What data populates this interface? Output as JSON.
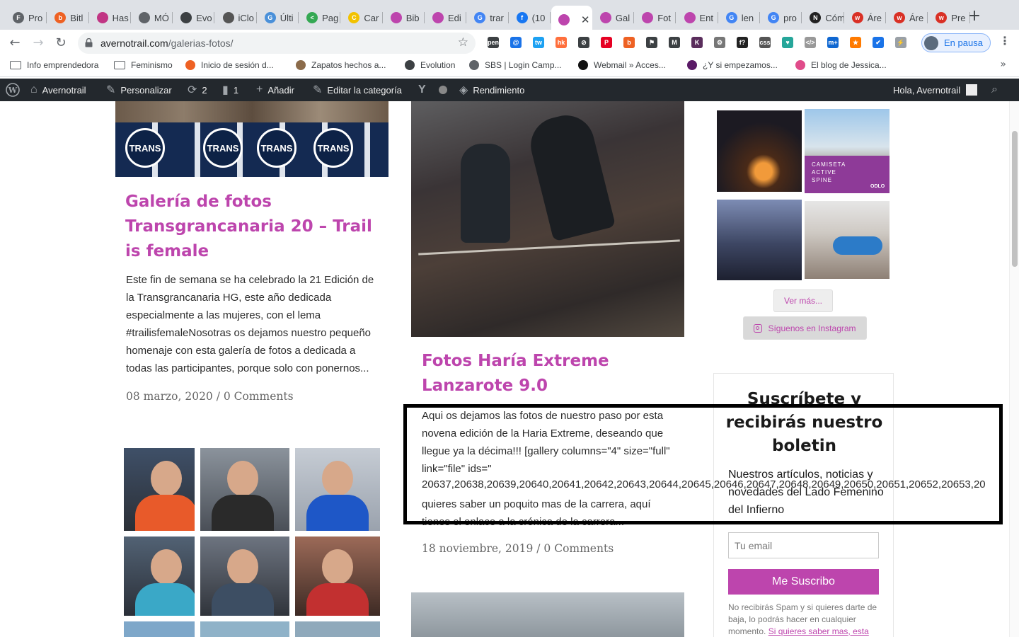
{
  "browser": {
    "tabs": [
      {
        "label": "Pro",
        "icon": "FB",
        "color": "#5f6368"
      },
      {
        "label": "Bitl",
        "icon": "b",
        "color": "#ee6123"
      },
      {
        "label": "Has",
        "icon": "ig",
        "color": "#c13584"
      },
      {
        "label": "MÓ",
        "icon": "globe",
        "color": "#5f6368"
      },
      {
        "label": "Evo",
        "icon": "oo",
        "color": "#3c4043"
      },
      {
        "label": "iClo",
        "icon": "apple",
        "color": "#555555"
      },
      {
        "label": "Últi",
        "icon": "GT",
        "color": "#4a90d9"
      },
      {
        "label": "Pag",
        "icon": "<>",
        "color": "#34a853"
      },
      {
        "label": "Car",
        "icon": "C",
        "color": "#f2c200"
      },
      {
        "label": "Bib",
        "icon": "crown",
        "color": "#bd45ad"
      },
      {
        "label": "Edi",
        "icon": "crown",
        "color": "#bd45ad"
      },
      {
        "label": "trar",
        "icon": "G",
        "color": "#4285f4"
      },
      {
        "label": "(10",
        "icon": "f",
        "color": "#1877f2"
      },
      {
        "label": "",
        "icon": "crown",
        "color": "#bd45ad"
      },
      {
        "label": "Gal",
        "icon": "crown",
        "color": "#bd45ad"
      },
      {
        "label": "Fot",
        "icon": "crown",
        "color": "#bd45ad"
      },
      {
        "label": "Ent",
        "icon": "crown",
        "color": "#bd45ad"
      },
      {
        "label": "len",
        "icon": "G",
        "color": "#4285f4"
      },
      {
        "label": "pro",
        "icon": "G",
        "color": "#4285f4"
      },
      {
        "label": "Cóm",
        "icon": "NB",
        "color": "#222222"
      },
      {
        "label": "Áre",
        "icon": "w",
        "color": "#d93025"
      },
      {
        "label": "Áre",
        "icon": "w",
        "color": "#d93025"
      },
      {
        "label": "Pre",
        "icon": "w",
        "color": "#d93025"
      }
    ],
    "active_close": "✕",
    "new_tab": "+",
    "url_host": "avernotrail.com",
    "url_path": "/galerias-fotos/",
    "profile_label": "En pausa",
    "extensions": [
      {
        "icon": "pen",
        "color": "#3c4043"
      },
      {
        "icon": "@",
        "color": "#1a73e8"
      },
      {
        "icon": "tw",
        "color": "#1da1f2"
      },
      {
        "icon": "hk",
        "color": "#ff6f3c"
      },
      {
        "icon": "⊘",
        "color": "#3c4043"
      },
      {
        "icon": "P",
        "color": "#e60023"
      },
      {
        "icon": "b",
        "color": "#ee6123"
      },
      {
        "icon": "⚑",
        "color": "#3c4043"
      },
      {
        "icon": "M",
        "color": "#3c4043"
      },
      {
        "icon": "K",
        "color": "#5a2d5c"
      },
      {
        "icon": "⚙",
        "color": "#777777"
      },
      {
        "icon": "f?",
        "color": "#222222"
      },
      {
        "icon": "css",
        "color": "#555555"
      },
      {
        "icon": "♥",
        "color": "#26a69a"
      },
      {
        "icon": "</>",
        "color": "#999999"
      },
      {
        "icon": "m+",
        "color": "#0f67d1"
      },
      {
        "icon": "★",
        "color": "#ff7a00"
      },
      {
        "icon": "✔",
        "color": "#1a73e8"
      },
      {
        "icon": "⚡",
        "color": "#9aa0a6"
      }
    ],
    "bookmarks": [
      {
        "label": "Info emprendedora",
        "icon": "folder"
      },
      {
        "label": "Feminismo",
        "icon": "folder"
      },
      {
        "label": "Inicio de sesión d...",
        "icon": "link"
      },
      {
        "label": "Zapatos hechos a...",
        "icon": "shoe"
      },
      {
        "label": "Evolution",
        "icon": "oo"
      },
      {
        "label": "SBS | Login Camp...",
        "icon": "globe"
      },
      {
        "label": "Webmail » Acces...",
        "icon": "I"
      },
      {
        "label": "¿Y si empezamos...",
        "icon": "bb"
      },
      {
        "label": "El blog de Jessica...",
        "icon": "pink"
      }
    ],
    "bookmarks_more": "»"
  },
  "adminbar": {
    "site": "Avernotrail",
    "customize": "Personalizar",
    "updates": "2",
    "comments": "1",
    "add": "Añadir",
    "edit_category": "Editar la categoría",
    "performance": "Rendimiento",
    "greeting": "Hola, Avernotrail"
  },
  "posts": [
    {
      "title": "Galería de fotos Transgrancanaria 20 – Trail is female",
      "excerpt": "Este fin de semana se ha celebrado la 21 Edición de la Transgrancanaria HG, este año dedicada especialmente a las mujeres, con el lema #trailisfemaleNosotras os dejamos nuestro pequeño homenaje con esta galería de fotos a dedicada a todas las participantes, porque solo con ponernos...",
      "meta": "08 marzo, 2020 / 0 Comments",
      "image_text": "TRANS"
    },
    {
      "title": "Fotos Haría Extreme Lanzarote 9.0",
      "excerpt": "Aqui os dejamos las fotos de nuestro paso por esta novena edición de la Haria Extreme, deseando que llegue ya la décima!!! [gallery columns=\"4\" size=\"full\" link=\"file\" ids=\"",
      "excerpt_tail": "quieres saber un poquito mas de la carrera, aquí tienes el enlace a la crónica de la carrera...",
      "ids_overflow": "20637,20638,20639,20640,20641,20642,20643,20644,20645,20646,20647,20648,20649,20650,20651,20652,20653,20",
      "meta": "18 noviembre, 2019 / 0 Comments"
    }
  ],
  "sidebar": {
    "instagram_tile_text": [
      "CAMISETA",
      "ACTIVE",
      "SPINE"
    ],
    "instagram_tile_brand": "ODLO",
    "see_more": "Ver más...",
    "follow_instagram": "Síguenos en Instagram",
    "newsletter": {
      "title": "Suscríbete y recibirás nuestro boletin",
      "subtitle": "Nuestros artículos, noticias y novedades del Lado Femenino del Infierno",
      "email_placeholder": "Tu email",
      "submit": "Me Suscribo",
      "note": "No recibirás Spam y si quieres darte de baja, lo podrás hacer en cualquier momento.",
      "note_link": "Si quieres saber mas, esta"
    }
  },
  "colors": {
    "accent": "#bd45ad",
    "admin_bar": "#23282d",
    "highlight": "#000000"
  }
}
